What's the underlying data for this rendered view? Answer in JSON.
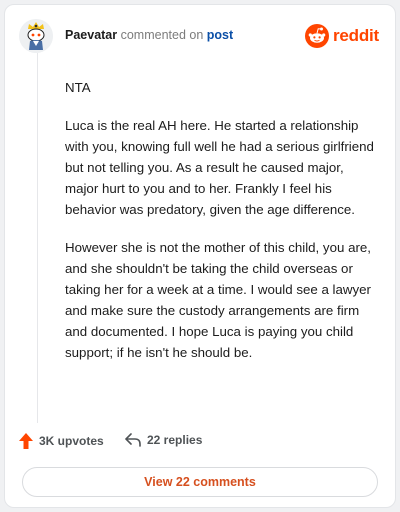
{
  "comment": {
    "username": "Paevatar",
    "action_text": "commented on",
    "post_link": "post",
    "brand": "reddit",
    "paragraphs": [
      "NTA",
      "Luca is the real AH here. He started a relationship with you, knowing full well he had a serious girlfriend but not telling you. As a result he caused major, major hurt to you and to her. Frankly I feel his behavior was predatory, given the age difference.",
      "However she is not the mother of this child, you are, and she shouldn't be taking the child overseas or taking her for a week at a time. I would see a lawyer and make sure the custody arrangements are firm and documented. I hope Luca is paying you child support; if he isn't he should be."
    ],
    "upvotes": "3K upvotes",
    "replies": "22 replies",
    "view_button": "View 22 comments"
  },
  "colors": {
    "brand": "#ff4500",
    "upvote": "#ff4500",
    "link": "#0b4fa7",
    "view_button_text": "#d6501f"
  },
  "icons": {
    "avatar": "snoo-avatar-with-hat",
    "brand": "reddit-snoo-icon",
    "upvote": "upvote-arrow-icon",
    "reply": "reply-arrow-icon"
  }
}
